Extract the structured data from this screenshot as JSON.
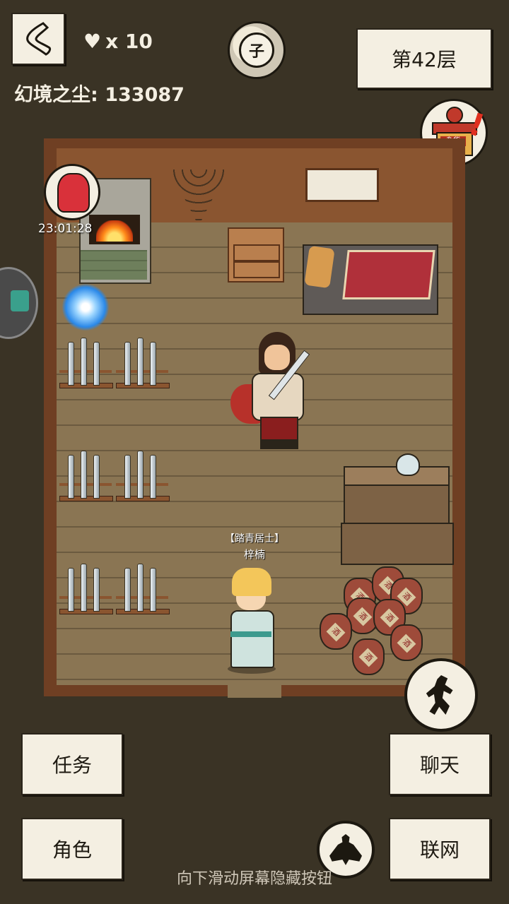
{
  "header": {
    "lives_symbol": "♥",
    "lives_text": "x 10",
    "dust_label": "幻境之尘:",
    "dust_value": "133087",
    "clock_char": "子",
    "floor": "第42层"
  },
  "shop": {
    "sign": "杂货",
    "alert": "!"
  },
  "gift": {
    "timer": "23:01:28"
  },
  "npc": {
    "title": "【踏青居士】",
    "name": "梓楠"
  },
  "jar_label": "酒",
  "buttons": {
    "task": "任务",
    "chat": "聊天",
    "role": "角色",
    "network": "联网",
    "network_alert": "!"
  },
  "hint": "向下滑动屏幕隐藏按钮",
  "colors": {
    "background": "#3a3325",
    "panel": "#f4efe2",
    "ink": "#1c1810",
    "floor_wood": "#8a7553",
    "alert_red": "#e03020"
  },
  "icons": {
    "back": "back-chevron-icon",
    "heart": "heart-icon",
    "clock": "time-emblem-icon",
    "shop": "shop-icon",
    "gift": "gift-bag-icon",
    "run": "run-icon",
    "meditate": "meditate-icon"
  }
}
